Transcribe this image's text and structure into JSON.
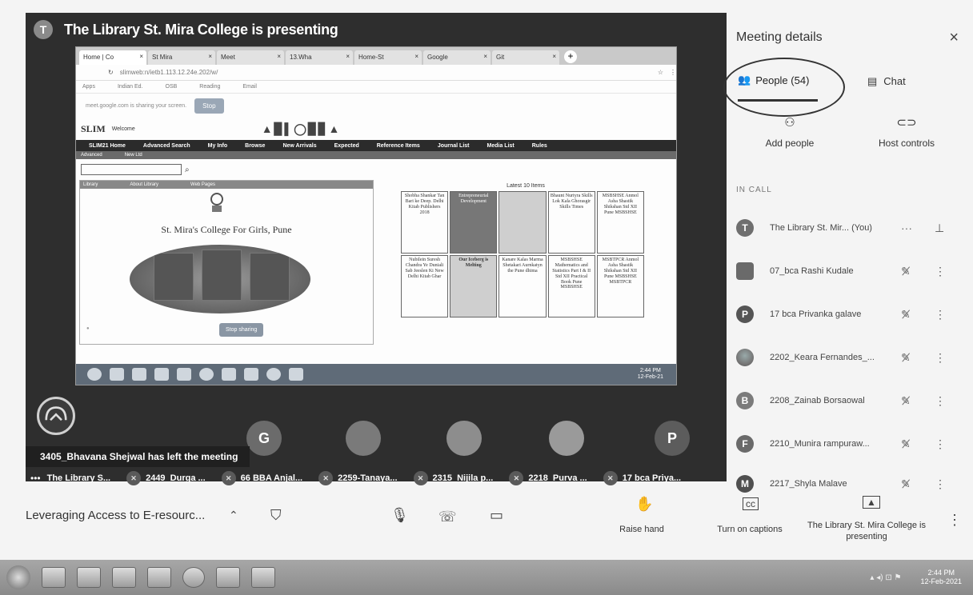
{
  "presenter": {
    "avatar_letter": "T",
    "banner": "The Library St. Mira College is presenting"
  },
  "browser": {
    "tabs": [
      "Home | Co",
      "St Mira",
      "Meet",
      "13.Wha",
      "Home-St",
      "Google",
      "Git"
    ],
    "address": "slimweb:n/ietb1.113.12.24e.202/w/",
    "bookmarks": [
      "Apps",
      "Indian Ed.",
      "OSB",
      "Reading",
      "Email"
    ]
  },
  "share_notice": {
    "text": "meet.google.com is sharing your screen.",
    "stop": "Stop"
  },
  "slim": {
    "logo": "SLIM",
    "welcome": "Welcome",
    "nav": [
      "SLIM21 Home",
      "Advanced Search",
      "My Info",
      "Browse",
      "New Arrivals",
      "Expected",
      "Reference Items",
      "Journal List",
      "Media List",
      "Rules"
    ],
    "subnav": [
      "Advanced",
      "New Ltd"
    ],
    "left_tabs": [
      "Library",
      "About Library",
      "Web Pages"
    ],
    "college_name": "St. Mira's College For Girls, Pune",
    "stop_sharing": "Stop sharing",
    "latest_title": "Latest 10 Items",
    "books": [
      "Shobha Shankar Tan Bari ke Deep. Delhi Kitab Publishers 2018",
      "",
      "",
      "Bhaunt Nurtyra Skills Lok Kala Ghorasgir Skills Times",
      "MSBSHSE Anmol Asha Shastik Shikshan Std XII Pune MSBSHSE",
      "Nubilein Suresh Chandra Ye Duniali Sab Jeeslen Ki New Delhi Kitab Ghar",
      "",
      "Kanare Kalas Marma Shetakari Aurnkatyn the Pune dhima",
      "MSBSHSE Mathematics and Statistics Part I & II Std XII Practical Book Pune MSBSHSE",
      "MSBTPCR Anmol Asha Shastik Shikshan Std XII Pune MSBSHSE MSBTPCR"
    ],
    "book_covers": [
      "",
      "Entrepreneurial Development",
      "",
      "",
      "",
      "",
      "Our Iceberg is Melting",
      "",
      "",
      ""
    ]
  },
  "inner_taskbar": {
    "time": "2:44 PM",
    "date": "12-Feb-21",
    "lang": "EN"
  },
  "strip": {
    "avatars": [
      {
        "letter": "G",
        "color": "#6b6b6b"
      },
      {
        "letter": "",
        "color": "#7a7a7a"
      },
      {
        "letter": "",
        "color": "#8d8d8d"
      },
      {
        "letter": "",
        "color": "#9a9a9a"
      },
      {
        "letter": "P",
        "color": "#5c5c5c"
      }
    ],
    "toast": "3405_Bhavana Shejwal has left the meeting",
    "names": [
      "The Library S...",
      "2449_Durga ...",
      "66 BBA Anjal...",
      "2259-Tanaya...",
      "2315_Nijila p...",
      "2218_Purva ...",
      "17 bca Priya..."
    ]
  },
  "controls": {
    "meeting_title": "Leveraging Access to E-resourc...",
    "raise_hand": "Raise hand",
    "captions": "Turn on captions",
    "presenting": "The Library St. Mira College is presenting"
  },
  "panel": {
    "title": "Meeting details",
    "people_tab": "People (54)",
    "chat_tab": "Chat",
    "add_people": "Add people",
    "host_controls": "Host controls",
    "in_call": "IN CALL",
    "participants": [
      {
        "letter": "T",
        "name": "The Library St. Mir... (You)",
        "kind": "letter"
      },
      {
        "letter": "",
        "name": "07_bca Rashi Kudale",
        "kind": "img"
      },
      {
        "letter": "P",
        "name": "17 bca Privanka galave",
        "kind": "letter"
      },
      {
        "letter": "",
        "name": "2202_Keara Fernandes_...",
        "kind": "img2"
      },
      {
        "letter": "B",
        "name": "2208_Zainab Borsaowal",
        "kind": "letter"
      },
      {
        "letter": "F",
        "name": "2210_Munira rampuraw...",
        "kind": "letter"
      },
      {
        "letter": "M",
        "name": "2217_Shyla Malave",
        "kind": "letter"
      }
    ]
  },
  "os_taskbar": {
    "time": "2:44 PM",
    "date": "12-Feb-2021"
  }
}
